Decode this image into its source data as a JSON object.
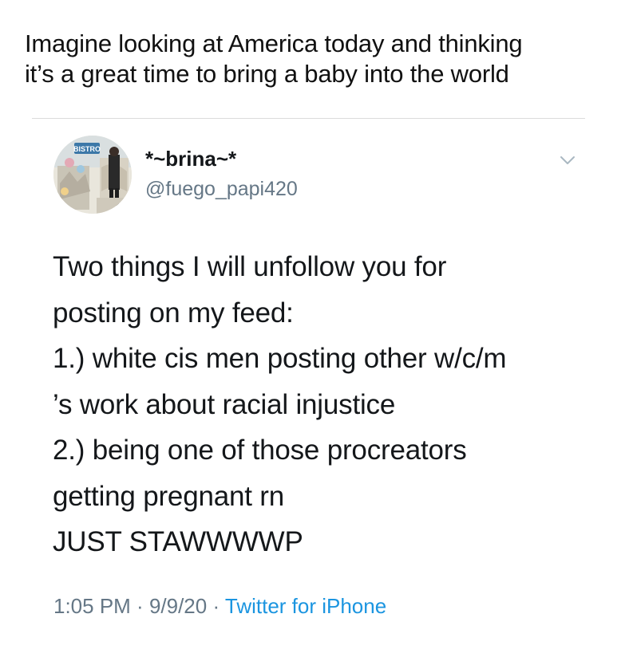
{
  "caption": {
    "lines": [
      "Imagine looking at America today and thinking",
      "it’s a great time to bring a baby into the world"
    ]
  },
  "tweet": {
    "avatar_icon": "profile-photo-icon",
    "avatar_sign_text": "BISTRO",
    "display_name": "*~brina~*",
    "handle": "@fuego_papi420",
    "menu_icon": "chevron-down-icon",
    "body_lines": [
      "Two things I will unfollow you for",
      "posting on my feed:",
      "1.) white cis men posting other w/c/m",
      "’s work about racial injustice",
      "2.) being one of those procreators",
      "getting pregnant rn",
      "JUST STAWWWWP"
    ],
    "time": "1:05 PM",
    "separator": " · ",
    "date": "9/9/20",
    "source": "Twitter for iPhone",
    "source_color": "#1b95e0"
  }
}
